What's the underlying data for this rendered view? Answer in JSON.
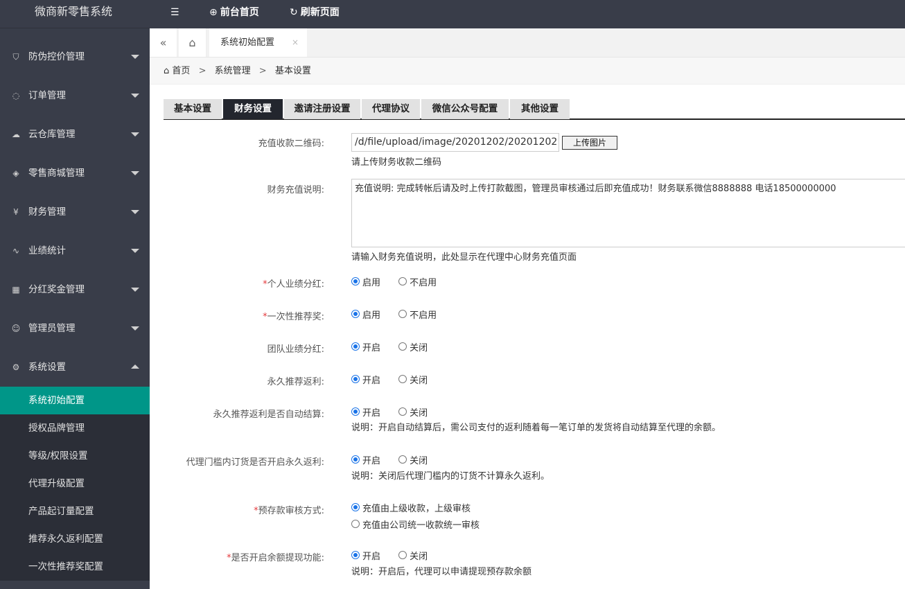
{
  "app": {
    "title": "微商新零售系统"
  },
  "header": {
    "home_label": "前台首页",
    "refresh_label": "刷新页面"
  },
  "sidebar": {
    "items": [
      {
        "label": "防伪控价管理",
        "icon": "shield-icon"
      },
      {
        "label": "订单管理",
        "icon": "order-icon"
      },
      {
        "label": "云仓库管理",
        "icon": "cloud-icon"
      },
      {
        "label": "零售商城管理",
        "icon": "cube-icon"
      },
      {
        "label": "财务管理",
        "icon": "yen-icon"
      },
      {
        "label": "业绩统计",
        "icon": "pulse-icon"
      },
      {
        "label": "分红奖金管理",
        "icon": "grid-icon"
      },
      {
        "label": "管理员管理",
        "icon": "user-icon"
      },
      {
        "label": "系统设置",
        "icon": "gear-icon"
      }
    ],
    "subitems": [
      "系统初始配置",
      "授权品牌管理",
      "等级/权限设置",
      "代理升级配置",
      "产品起订量配置",
      "推荐永久返利配置",
      "一次性推荐奖配置"
    ]
  },
  "tabbar": {
    "active_tab": "系统初始配置",
    "close": "×"
  },
  "breadcrumb": {
    "home": "首页",
    "level1": "系统管理",
    "level2": "基本设置",
    "sep": ">"
  },
  "content_tabs": [
    "基本设置",
    "财务设置",
    "邀请注册设置",
    "代理协议",
    "微信公众号配置",
    "其他设置"
  ],
  "form": {
    "qr_label": "充值收款二维码:",
    "qr_value": "/d/file/upload/image/20201202/20201202",
    "upload_label": "上传图片",
    "qr_help": "请上传财务收款二维码",
    "desc_label": "财务充值说明:",
    "desc_value": "充值说明: 完成转帐后请及时上传打款截图，管理员审核通过后即充值成功！财务联系微信8888888 电话18500000000",
    "desc_help": "请输入财务充值说明，此处显示在代理中心财务充值页面",
    "personal_label": "个人业绩分红:",
    "onetime_label": "一次性推荐奖:",
    "team_label": "团队业绩分红:",
    "perm_label": "永久推荐返利:",
    "auto_label": "永久推荐返利是否自动结算:",
    "auto_help": "说明：开启自动结算后，需公司支付的返利随着每一笔订单的发货将自动结算至代理的余额。",
    "threshold_label": "代理门槛内订货是否开启永久返利:",
    "threshold_help": "说明：关闭后代理门槛内的订货不计算永久返利。",
    "deposit_label": "预存款审核方式:",
    "deposit_opt1": "充值由上级收款，上级审核",
    "deposit_opt2": "充值由公司统一收款统一审核",
    "withdraw_label": "是否开启余额提现功能:",
    "withdraw_help": "说明：开启后，代理可以申请提现预存款余额",
    "enable": "启用",
    "disable": "不启用",
    "open": "开启",
    "close": "关闭",
    "required_mark": "*"
  }
}
